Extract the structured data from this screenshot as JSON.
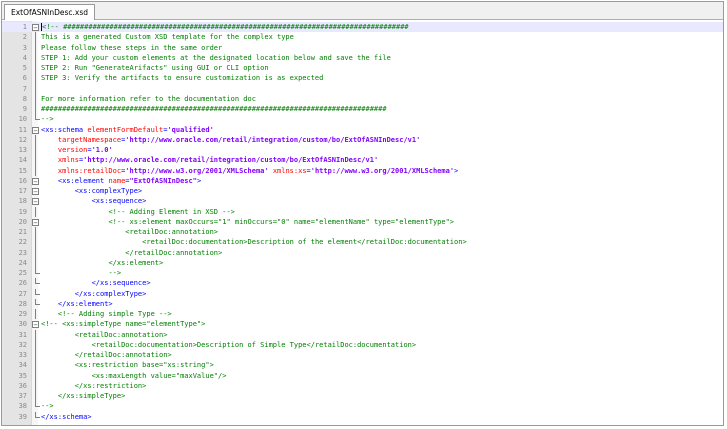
{
  "tab": {
    "label": "ExtOfASNInDesc.xsd"
  },
  "lines": [
    {
      "n": "1",
      "fold": "box",
      "segs": [
        {
          "c": "comment",
          "t": "<!-- ##################################################################################"
        }
      ]
    },
    {
      "n": "2",
      "fold": "bar",
      "segs": [
        {
          "c": "comment",
          "t": "This is a generated Custom XSD template for the complex type"
        }
      ]
    },
    {
      "n": "3",
      "fold": "bar",
      "segs": [
        {
          "c": "comment",
          "t": "Please follow these steps in the same order"
        }
      ]
    },
    {
      "n": "4",
      "fold": "bar",
      "segs": [
        {
          "c": "comment",
          "t": "STEP 1: Add your custom elements at the designated location below and save the file"
        }
      ]
    },
    {
      "n": "5",
      "fold": "bar",
      "segs": [
        {
          "c": "comment",
          "t": "STEP 2: Run \"GenerateArifacts\" using GUI or CLI option"
        }
      ]
    },
    {
      "n": "6",
      "fold": "bar",
      "segs": [
        {
          "c": "comment",
          "t": "STEP 3: Verify the artifacts to ensure customization is as expected"
        }
      ]
    },
    {
      "n": "7",
      "fold": "bar",
      "segs": []
    },
    {
      "n": "8",
      "fold": "bar",
      "segs": [
        {
          "c": "comment",
          "t": "For more information refer to the documentation doc"
        }
      ]
    },
    {
      "n": "9",
      "fold": "bar",
      "segs": [
        {
          "c": "comment",
          "t": "##################################################################################"
        }
      ]
    },
    {
      "n": "10",
      "fold": "end",
      "segs": [
        {
          "c": "comment",
          "t": "-->"
        }
      ]
    },
    {
      "n": "11",
      "fold": "box",
      "segs": [
        {
          "c": "tag",
          "t": "<xs:schema "
        },
        {
          "c": "attr",
          "t": "elementFormDefault"
        },
        {
          "c": "tag",
          "t": "="
        },
        {
          "c": "val",
          "t": "'qualified'"
        }
      ]
    },
    {
      "n": "12",
      "fold": "bar",
      "segs": [
        {
          "c": "text",
          "t": "    "
        },
        {
          "c": "attr",
          "t": "targetNamespace"
        },
        {
          "c": "tag",
          "t": "="
        },
        {
          "c": "val",
          "t": "'http://www.oracle.com/retail/integration/custom/bo/ExtOfASNInDesc/v1'"
        }
      ]
    },
    {
      "n": "13",
      "fold": "bar",
      "segs": [
        {
          "c": "text",
          "t": "    "
        },
        {
          "c": "attr",
          "t": "version"
        },
        {
          "c": "tag",
          "t": "="
        },
        {
          "c": "val",
          "t": "'1.0'"
        }
      ]
    },
    {
      "n": "14",
      "fold": "bar",
      "segs": [
        {
          "c": "text",
          "t": "    "
        },
        {
          "c": "attr",
          "t": "xmlns"
        },
        {
          "c": "tag",
          "t": "="
        },
        {
          "c": "val",
          "t": "'http://www.oracle.com/retail/integration/custom/bo/ExtOfASNInDesc/v1'"
        }
      ]
    },
    {
      "n": "15",
      "fold": "bar",
      "segs": [
        {
          "c": "text",
          "t": "    "
        },
        {
          "c": "attr",
          "t": "xmlns:retailDoc"
        },
        {
          "c": "tag",
          "t": "="
        },
        {
          "c": "val",
          "t": "'http://www.w3.org/2001/XMLSchema'"
        },
        {
          "c": "text",
          "t": " "
        },
        {
          "c": "attr",
          "t": "xmlns:xs"
        },
        {
          "c": "tag",
          "t": "="
        },
        {
          "c": "val",
          "t": "'http://www.w3.org/2001/XMLSchema'"
        },
        {
          "c": "tag",
          "t": ">"
        }
      ]
    },
    {
      "n": "16",
      "fold": "box",
      "segs": [
        {
          "c": "text",
          "t": "    "
        },
        {
          "c": "tag",
          "t": "<xs:element "
        },
        {
          "c": "attr",
          "t": "name"
        },
        {
          "c": "tag",
          "t": "="
        },
        {
          "c": "val",
          "t": "\"ExtOfASNInDesc\""
        },
        {
          "c": "tag",
          "t": ">"
        }
      ]
    },
    {
      "n": "17",
      "fold": "box",
      "segs": [
        {
          "c": "text",
          "t": "        "
        },
        {
          "c": "tag",
          "t": "<xs:complexType>"
        }
      ]
    },
    {
      "n": "18",
      "fold": "box",
      "segs": [
        {
          "c": "text",
          "t": "            "
        },
        {
          "c": "tag",
          "t": "<xs:sequence>"
        }
      ]
    },
    {
      "n": "19",
      "fold": "bar",
      "segs": [
        {
          "c": "text",
          "t": "                "
        },
        {
          "c": "comment",
          "t": "<!-- Adding Element in XSD -->"
        }
      ]
    },
    {
      "n": "20",
      "fold": "box",
      "segs": [
        {
          "c": "text",
          "t": "                "
        },
        {
          "c": "comment",
          "t": "<!-- xs:element maxOccurs=\"1\" minOccurs=\"0\" name=\"elementName\" type=\"elementType\">"
        }
      ]
    },
    {
      "n": "21",
      "fold": "bar",
      "segs": [
        {
          "c": "text",
          "t": "                    "
        },
        {
          "c": "comment",
          "t": "<retailDoc:annotation>"
        }
      ]
    },
    {
      "n": "22",
      "fold": "bar",
      "segs": [
        {
          "c": "text",
          "t": "                        "
        },
        {
          "c": "comment",
          "t": "<retailDoc:documentation>Description of the element</retailDoc:documentation>"
        }
      ]
    },
    {
      "n": "23",
      "fold": "bar",
      "segs": [
        {
          "c": "text",
          "t": "                    "
        },
        {
          "c": "comment",
          "t": "</retailDoc:annotation>"
        }
      ]
    },
    {
      "n": "24",
      "fold": "bar",
      "segs": [
        {
          "c": "text",
          "t": "                "
        },
        {
          "c": "comment",
          "t": "</xs:element>"
        }
      ]
    },
    {
      "n": "25",
      "fold": "end",
      "segs": [
        {
          "c": "text",
          "t": "                "
        },
        {
          "c": "comment",
          "t": "-->"
        }
      ]
    },
    {
      "n": "26",
      "fold": "end",
      "segs": [
        {
          "c": "text",
          "t": "            "
        },
        {
          "c": "tag",
          "t": "</xs:sequence>"
        }
      ]
    },
    {
      "n": "27",
      "fold": "end",
      "segs": [
        {
          "c": "text",
          "t": "        "
        },
        {
          "c": "tag",
          "t": "</xs:complexType>"
        }
      ]
    },
    {
      "n": "28",
      "fold": "end",
      "segs": [
        {
          "c": "text",
          "t": "    "
        },
        {
          "c": "tag",
          "t": "</xs:element>"
        }
      ]
    },
    {
      "n": "29",
      "fold": "bar",
      "segs": [
        {
          "c": "text",
          "t": "    "
        },
        {
          "c": "comment",
          "t": "<!-- Adding simple Type -->"
        }
      ]
    },
    {
      "n": "30",
      "fold": "box",
      "segs": [
        {
          "c": "comment",
          "t": "<!-- <xs:simpleType name=\"elementType\">"
        }
      ]
    },
    {
      "n": "31",
      "fold": "bar",
      "segs": [
        {
          "c": "text",
          "t": "        "
        },
        {
          "c": "comment",
          "t": "<retailDoc:annotation>"
        }
      ]
    },
    {
      "n": "32",
      "fold": "bar",
      "segs": [
        {
          "c": "text",
          "t": "            "
        },
        {
          "c": "comment",
          "t": "<retailDoc:documentation>Description of Simple Type</retailDoc:documentation>"
        }
      ]
    },
    {
      "n": "33",
      "fold": "bar",
      "segs": [
        {
          "c": "text",
          "t": "        "
        },
        {
          "c": "comment",
          "t": "</retailDoc:annotation>"
        }
      ]
    },
    {
      "n": "34",
      "fold": "bar",
      "segs": [
        {
          "c": "text",
          "t": "        "
        },
        {
          "c": "comment",
          "t": "<xs:restriction base=\"xs:string\">"
        }
      ]
    },
    {
      "n": "35",
      "fold": "bar",
      "segs": [
        {
          "c": "text",
          "t": "            "
        },
        {
          "c": "comment",
          "t": "<xs:maxLength value=\"maxValue\"/>"
        }
      ]
    },
    {
      "n": "36",
      "fold": "bar",
      "segs": [
        {
          "c": "text",
          "t": "        "
        },
        {
          "c": "comment",
          "t": "</xs:restriction>"
        }
      ]
    },
    {
      "n": "37",
      "fold": "bar",
      "segs": [
        {
          "c": "text",
          "t": "    "
        },
        {
          "c": "comment",
          "t": "</xs:simpleType>"
        }
      ]
    },
    {
      "n": "38",
      "fold": "end",
      "segs": [
        {
          "c": "comment",
          "t": "-->"
        }
      ]
    },
    {
      "n": "39",
      "fold": "end",
      "segs": [
        {
          "c": "tag",
          "t": "</xs:schema>"
        }
      ]
    }
  ]
}
